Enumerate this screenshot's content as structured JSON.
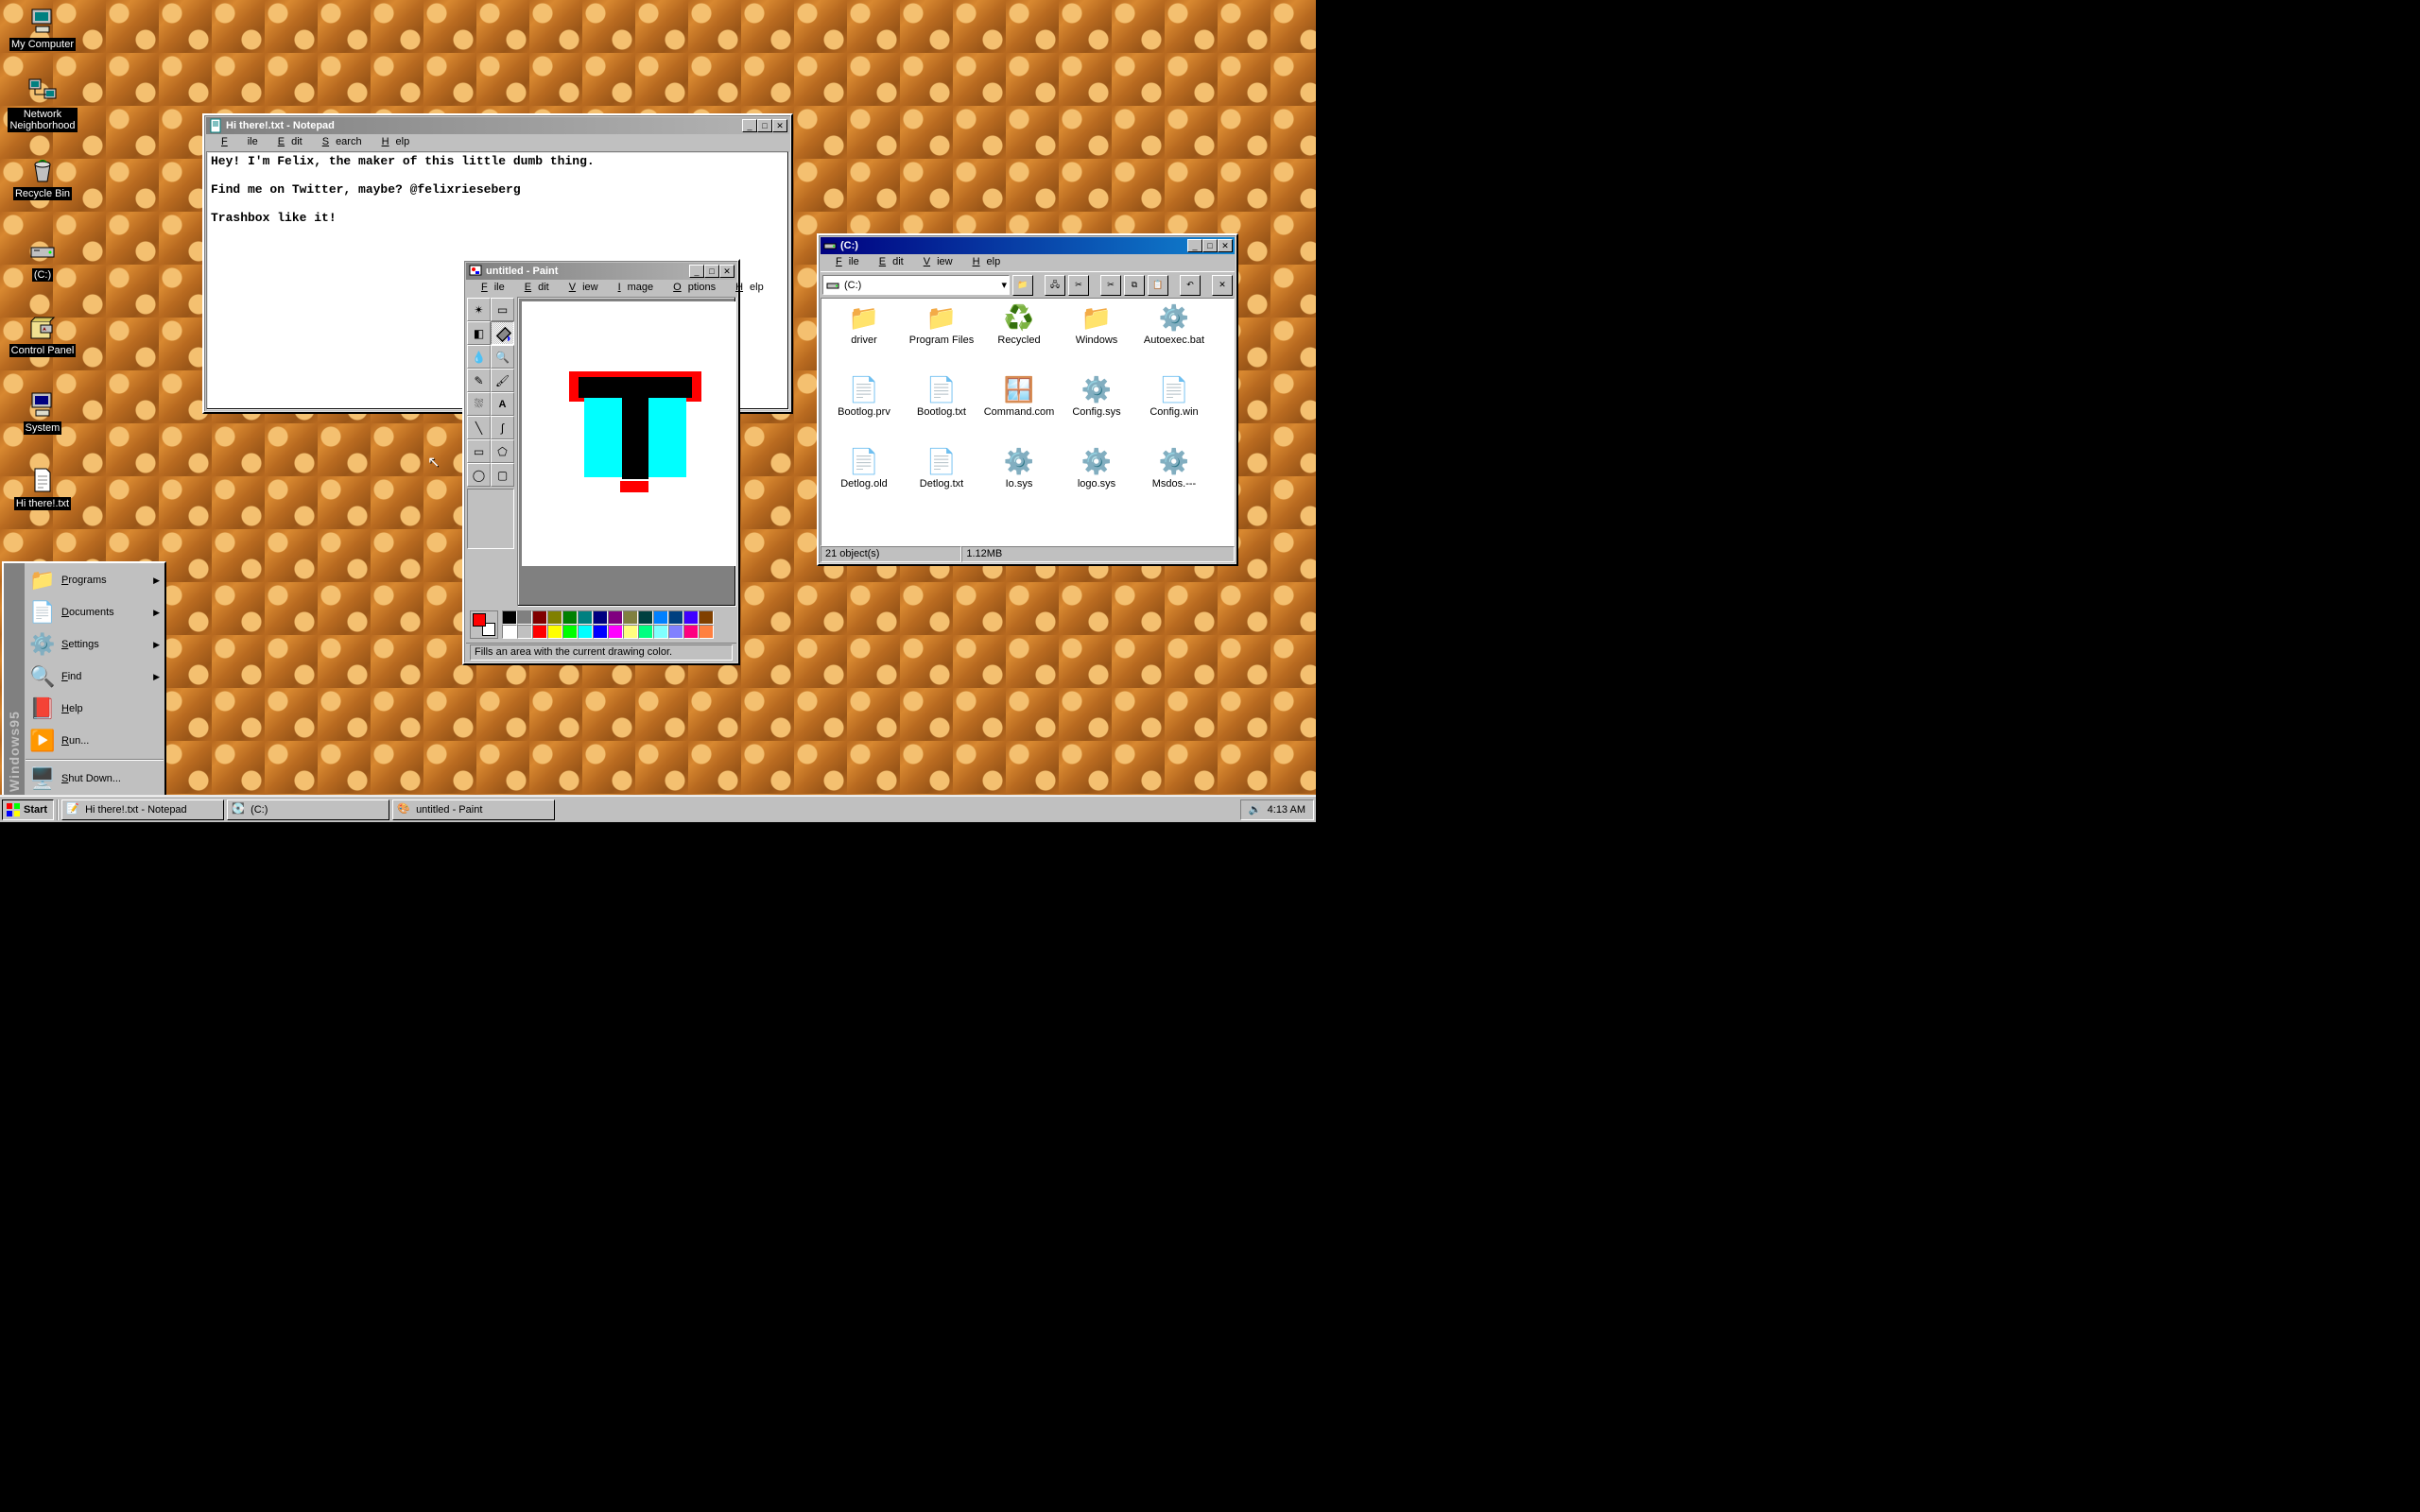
{
  "desktop": {
    "icons": [
      {
        "name": "my-computer",
        "label": "My Computer"
      },
      {
        "name": "network-neighborhood",
        "label": "Network\nNeighborhood"
      },
      {
        "name": "recycle-bin",
        "label": "Recycle Bin"
      },
      {
        "name": "drive-c",
        "label": "(C:)"
      },
      {
        "name": "control-panel",
        "label": "Control Panel"
      },
      {
        "name": "system",
        "label": "System"
      },
      {
        "name": "hi-there-txt",
        "label": "Hi there!.txt"
      }
    ]
  },
  "notepad": {
    "title": "Hi there!.txt - Notepad",
    "menu": [
      "File",
      "Edit",
      "Search",
      "Help"
    ],
    "text": "Hey! I'm Felix, the maker of this little dumb thing.\n\nFind me on Twitter, maybe? @felixrieseberg\n\nTrashbox like it!"
  },
  "paint": {
    "title": "untitled - Paint",
    "menu": [
      "File",
      "Edit",
      "View",
      "Image",
      "Options",
      "Help"
    ],
    "status": "Fills an area with the current drawing color.",
    "tools": [
      "free-select",
      "rect-select",
      "eraser",
      "fill",
      "eyedropper",
      "zoom",
      "pencil",
      "brush",
      "airbrush",
      "text",
      "line",
      "curve",
      "rectangle",
      "polygon",
      "ellipse",
      "rounded-rect"
    ],
    "selected_tool": "fill",
    "fg_color": "#ff0000",
    "bg_color": "#ffffff",
    "palette_row1": [
      "#000000",
      "#808080",
      "#800000",
      "#808000",
      "#008000",
      "#008080",
      "#000080",
      "#800080",
      "#808040",
      "#004040",
      "#0080ff",
      "#004080",
      "#4000ff",
      "#804000"
    ],
    "palette_row2": [
      "#ffffff",
      "#c0c0c0",
      "#ff0000",
      "#ffff00",
      "#00ff00",
      "#00ffff",
      "#0000ff",
      "#ff00ff",
      "#ffff80",
      "#00ff80",
      "#80ffff",
      "#8080ff",
      "#ff0080",
      "#ff8040"
    ]
  },
  "explorer": {
    "title": "(C:)",
    "menu": [
      "File",
      "Edit",
      "View",
      "Help"
    ],
    "address": "(C:)",
    "items": [
      {
        "type": "folder",
        "label": "driver"
      },
      {
        "type": "folder",
        "label": "Program Files"
      },
      {
        "type": "recycle",
        "label": "Recycled"
      },
      {
        "type": "folder",
        "label": "Windows"
      },
      {
        "type": "sys",
        "label": "Autoexec.bat"
      },
      {
        "type": "txt",
        "label": "Bootlog.prv"
      },
      {
        "type": "txt",
        "label": "Bootlog.txt"
      },
      {
        "type": "app",
        "label": "Command.com"
      },
      {
        "type": "sys",
        "label": "Config.sys"
      },
      {
        "type": "txt",
        "label": "Config.win"
      },
      {
        "type": "txt",
        "label": "Detlog.old"
      },
      {
        "type": "txt",
        "label": "Detlog.txt"
      },
      {
        "type": "sys",
        "label": "Io.sys"
      },
      {
        "type": "sys",
        "label": "logo.sys"
      },
      {
        "type": "sys",
        "label": "Msdos.---"
      }
    ],
    "status_objects": "21 object(s)",
    "status_size": "1.12MB"
  },
  "startmenu": {
    "band": "Windows95",
    "items": [
      {
        "icon": "programs-icon",
        "label": "Programs",
        "arrow": true
      },
      {
        "icon": "documents-icon",
        "label": "Documents",
        "arrow": true
      },
      {
        "icon": "settings-icon",
        "label": "Settings",
        "arrow": true
      },
      {
        "icon": "find-icon",
        "label": "Find",
        "arrow": true
      },
      {
        "icon": "help-icon",
        "label": "Help",
        "arrow": false
      },
      {
        "icon": "run-icon",
        "label": "Run...",
        "arrow": false
      },
      {
        "sep": true
      },
      {
        "icon": "shutdown-icon",
        "label": "Shut Down...",
        "arrow": false
      }
    ]
  },
  "taskbar": {
    "start": "Start",
    "tasks": [
      {
        "icon": "notepad-icon",
        "label": "Hi there!.txt - Notepad"
      },
      {
        "icon": "drive-icon",
        "label": "(C:)"
      },
      {
        "icon": "paint-icon",
        "label": "untitled - Paint"
      }
    ],
    "clock": "4:13 AM"
  }
}
